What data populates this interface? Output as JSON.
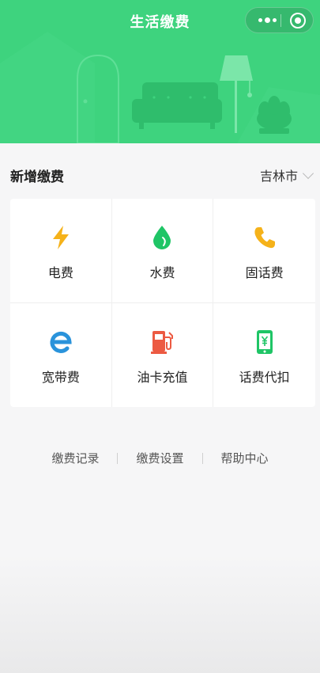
{
  "header": {
    "title": "生活缴费",
    "background_color": "#3ed37e"
  },
  "section": {
    "title": "新增缴费",
    "city": "吉林市"
  },
  "services": [
    {
      "label": "电费",
      "icon": "lightning-icon",
      "color": "#f5b21a"
    },
    {
      "label": "水费",
      "icon": "water-drop-icon",
      "color": "#1fc566"
    },
    {
      "label": "固话费",
      "icon": "phone-icon",
      "color": "#f5b21a"
    },
    {
      "label": "宽带费",
      "icon": "browser-e-icon",
      "color": "#2a93db"
    },
    {
      "label": "油卡充值",
      "icon": "fuel-pump-icon",
      "color": "#ec5a42"
    },
    {
      "label": "话费代扣",
      "icon": "mobile-yuan-icon",
      "color": "#1fc566"
    }
  ],
  "footer_links": [
    "缴费记录",
    "缴费设置",
    "帮助中心"
  ]
}
